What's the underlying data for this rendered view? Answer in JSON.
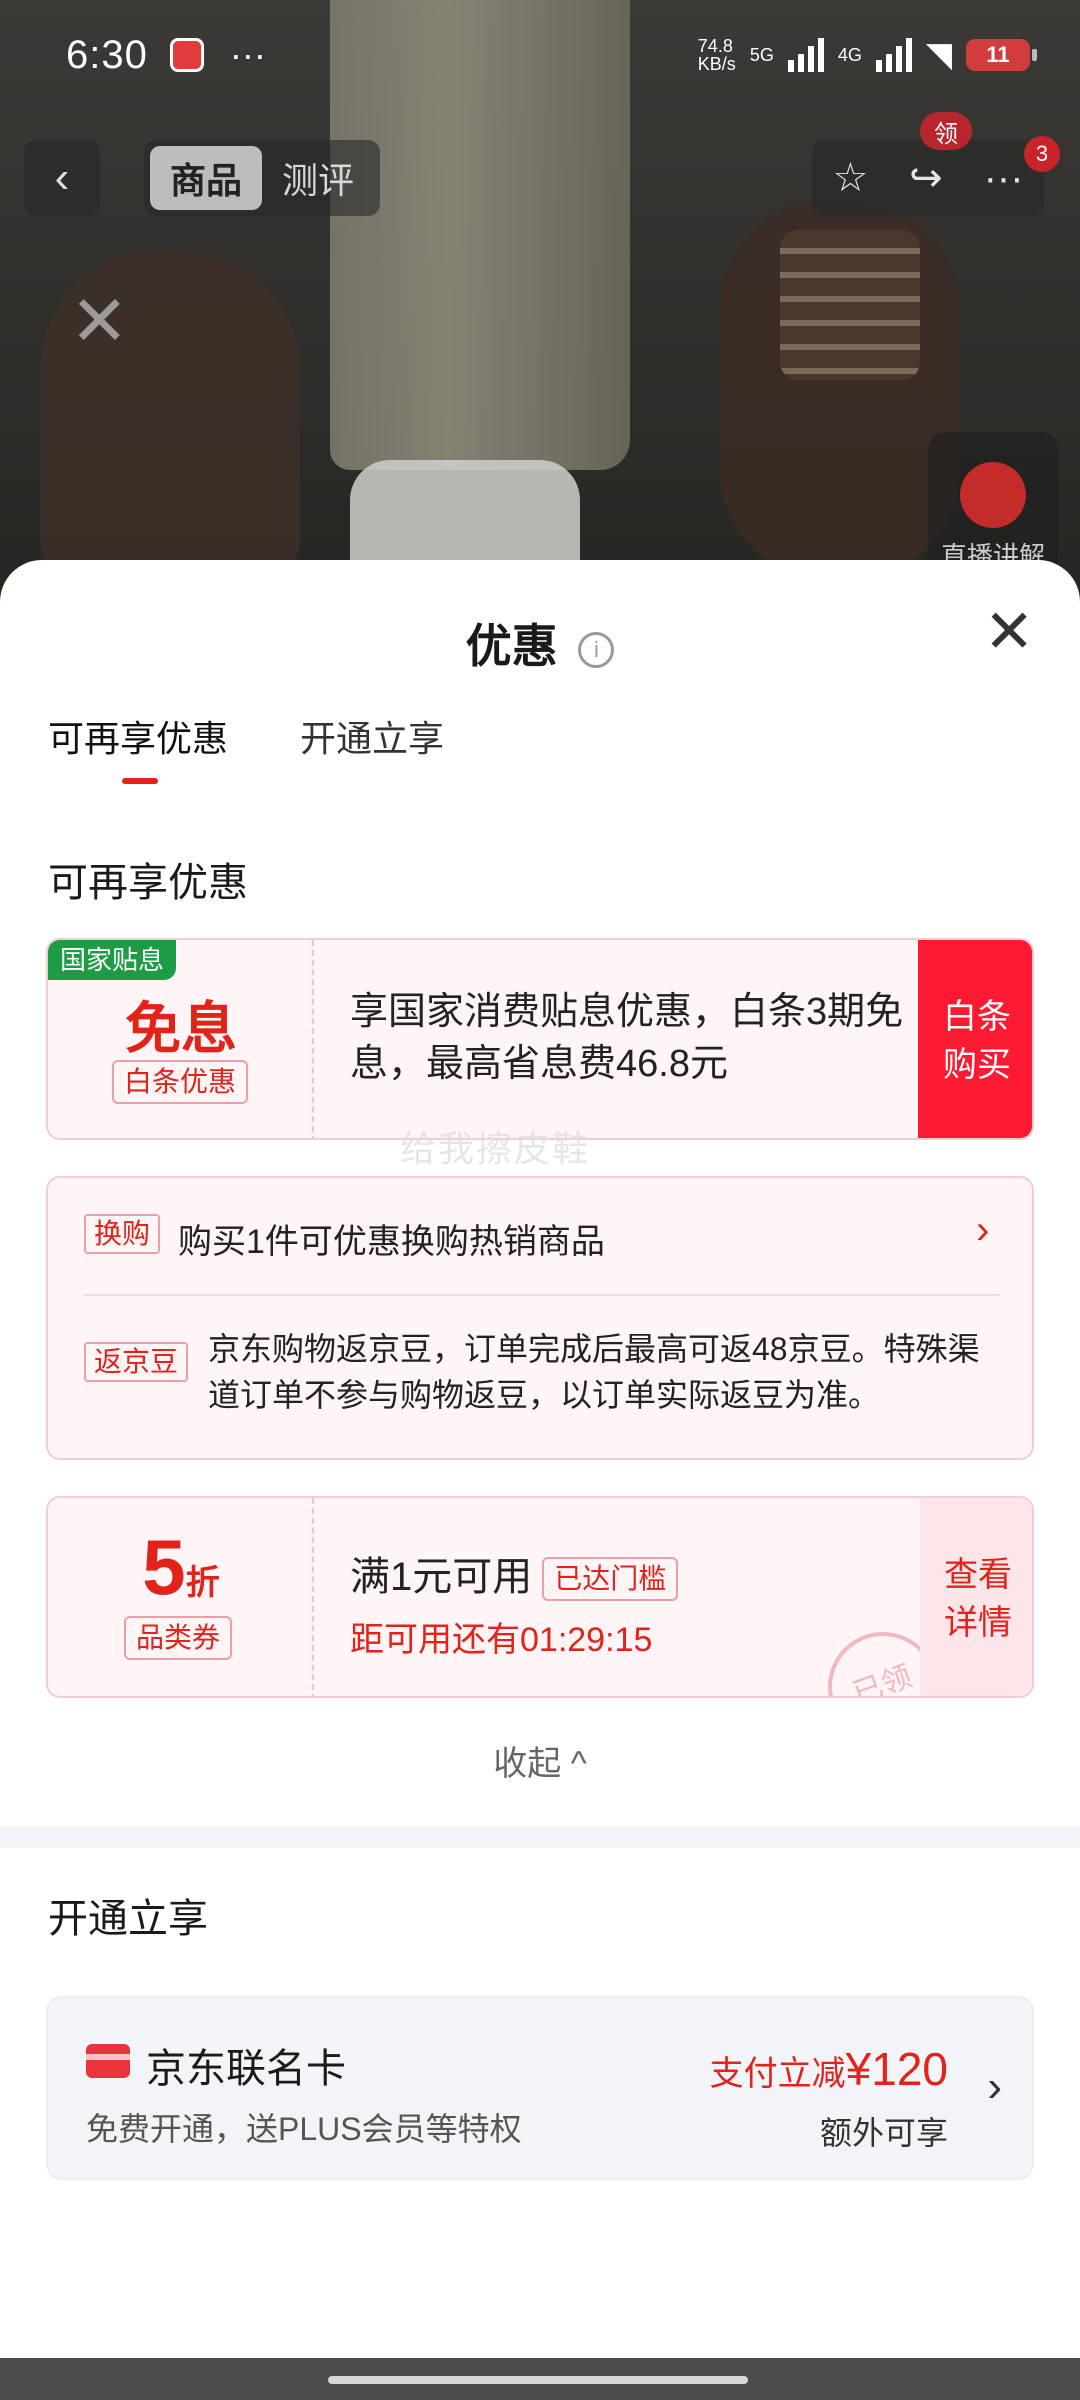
{
  "status_bar": {
    "time": "6:30",
    "more": "···",
    "net_speed": "74.8\nKB/s",
    "net_5g": "5G",
    "net_4g": "4G",
    "battery": "11"
  },
  "top_nav": {
    "tabs": [
      "商品",
      "测评"
    ],
    "coupon_badge": "领",
    "more_count": "3"
  },
  "live": {
    "label": "直播讲解"
  },
  "sheet": {
    "title": "优惠",
    "tabs": [
      "可再享优惠",
      "开通立享"
    ],
    "section1_title": "可再享优惠",
    "subsidy_card": {
      "tag": "国家贴息",
      "main": "免息",
      "sub": "白条优惠",
      "text": "享国家消费贴息优惠，白条3期免息，最高省息费46.8元",
      "button": "白条购买"
    },
    "watermark": "给我擦皮鞋",
    "promo_card": {
      "row1_tag": "换购",
      "row1_text": "购买1件可优惠换购热销商品",
      "row2_tag": "返京豆",
      "row2_text": "京东购物返京豆，订单完成后最高可返48京豆。特殊渠道订单不参与购物返豆，以订单实际返豆为准。"
    },
    "coupon_card": {
      "discount": "5",
      "discount_unit": "折",
      "type": "品类券",
      "condition": "满1元可用",
      "status_tag": "已达门槛",
      "countdown": "距可用还有01:29:15",
      "button": "查看详情",
      "stamp": "已领"
    },
    "collapse_label": "收起 ^",
    "section2_title": "开通立享",
    "card_offer": {
      "title": "京东联名卡",
      "subtitle": "免费开通，送PLUS会员等特权",
      "price_prefix": "支付立减",
      "price": "¥120",
      "extra": "额外可享"
    }
  },
  "colors": {
    "accent": "#e2231a",
    "button_red": "#fb1a32",
    "tag_green": "#1e9b45"
  }
}
